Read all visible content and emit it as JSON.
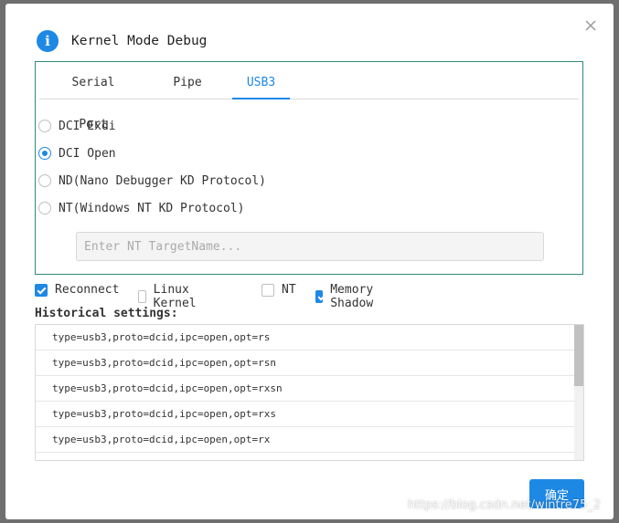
{
  "dialog": {
    "title": "Kernel Mode Debug",
    "icon": "info-icon",
    "close_icon": "close-icon"
  },
  "tabs": [
    {
      "label": "Serial Port",
      "active": false
    },
    {
      "label": "Pipe",
      "active": false
    },
    {
      "label": "USB3",
      "active": true
    }
  ],
  "protocols": [
    {
      "label": "DCI Exdi",
      "selected": false
    },
    {
      "label": "DCI Open",
      "selected": true
    },
    {
      "label": "ND(Nano Debugger KD Protocol)",
      "selected": false
    },
    {
      "label": "NT(Windows NT KD Protocol)",
      "selected": false
    }
  ],
  "target_input": {
    "value": "",
    "placeholder": "Enter NT TargetName..."
  },
  "options": [
    {
      "label": "Reconnect",
      "checked": true
    },
    {
      "label": "Linux Kernel",
      "checked": false
    },
    {
      "label": "NT",
      "checked": false
    },
    {
      "label": "Memory Shadow",
      "checked": true
    }
  ],
  "history": {
    "label": "Historical settings:",
    "items": [
      "type=usb3,proto=dcid,ipc=open,opt=rs",
      "type=usb3,proto=dcid,ipc=open,opt=rsn",
      "type=usb3,proto=dcid,ipc=open,opt=rxsn",
      "type=usb3,proto=dcid,ipc=open,opt=rxs",
      "type=usb3,proto=dcid,ipc=open,opt=rx"
    ]
  },
  "ok_button": {
    "label": "确定"
  },
  "watermark": "https://blog.csdn.net/wintre75_2",
  "colors": {
    "accent": "#1e88e5",
    "frame": "#2e8b7a"
  }
}
